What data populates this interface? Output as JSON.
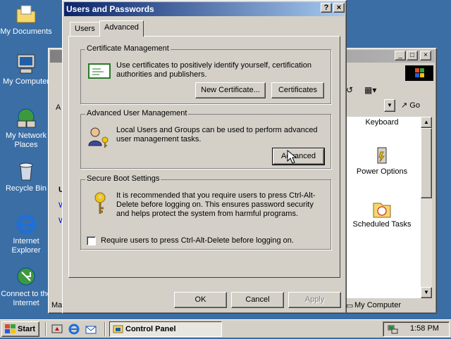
{
  "desktop": {
    "icons": [
      {
        "label": "My Documents"
      },
      {
        "label": "My Computer"
      },
      {
        "label": "My Network Places"
      },
      {
        "label": "Recycle Bin"
      },
      {
        "label": "Internet Explorer"
      },
      {
        "label": "Connect to the Internet"
      }
    ]
  },
  "control_panel": {
    "address_letter": "A",
    "go_label": "Go",
    "items": [
      {
        "label": "Keyboard"
      },
      {
        "label": "Power Options"
      },
      {
        "label": "Scheduled Tasks"
      }
    ],
    "left_letters": [
      "U",
      "W",
      "W"
    ],
    "status_left": "Mar",
    "status_right": "My Computer"
  },
  "dialog": {
    "title": "Users and Passwords",
    "help_btn": "?",
    "close_btn": "×",
    "tabs": [
      "Users",
      "Advanced"
    ],
    "active_tab": "Advanced",
    "cert": {
      "heading": "Certificate Management",
      "text": "Use certificates to positively identify yourself, certification authorities and publishers.",
      "btn_new": "New Certificate...",
      "btn_certs": "Certificates"
    },
    "aum": {
      "heading": "Advanced User Management",
      "text": "Local Users and Groups can be used to perform advanced user management tasks.",
      "btn_advanced": "Advanced"
    },
    "boot": {
      "heading": "Secure Boot Settings",
      "text": "It is recommended that you require users to press Ctrl-Alt-Delete before logging on. This ensures password security and helps protect the system from harmful programs.",
      "checkbox_label": "Require users to press Ctrl-Alt-Delete before logging on.",
      "checked": false
    },
    "ok": "OK",
    "cancel": "Cancel",
    "apply": "Apply"
  },
  "taskbar": {
    "start": "Start",
    "task": "Control Panel",
    "clock": "1:58 PM"
  }
}
